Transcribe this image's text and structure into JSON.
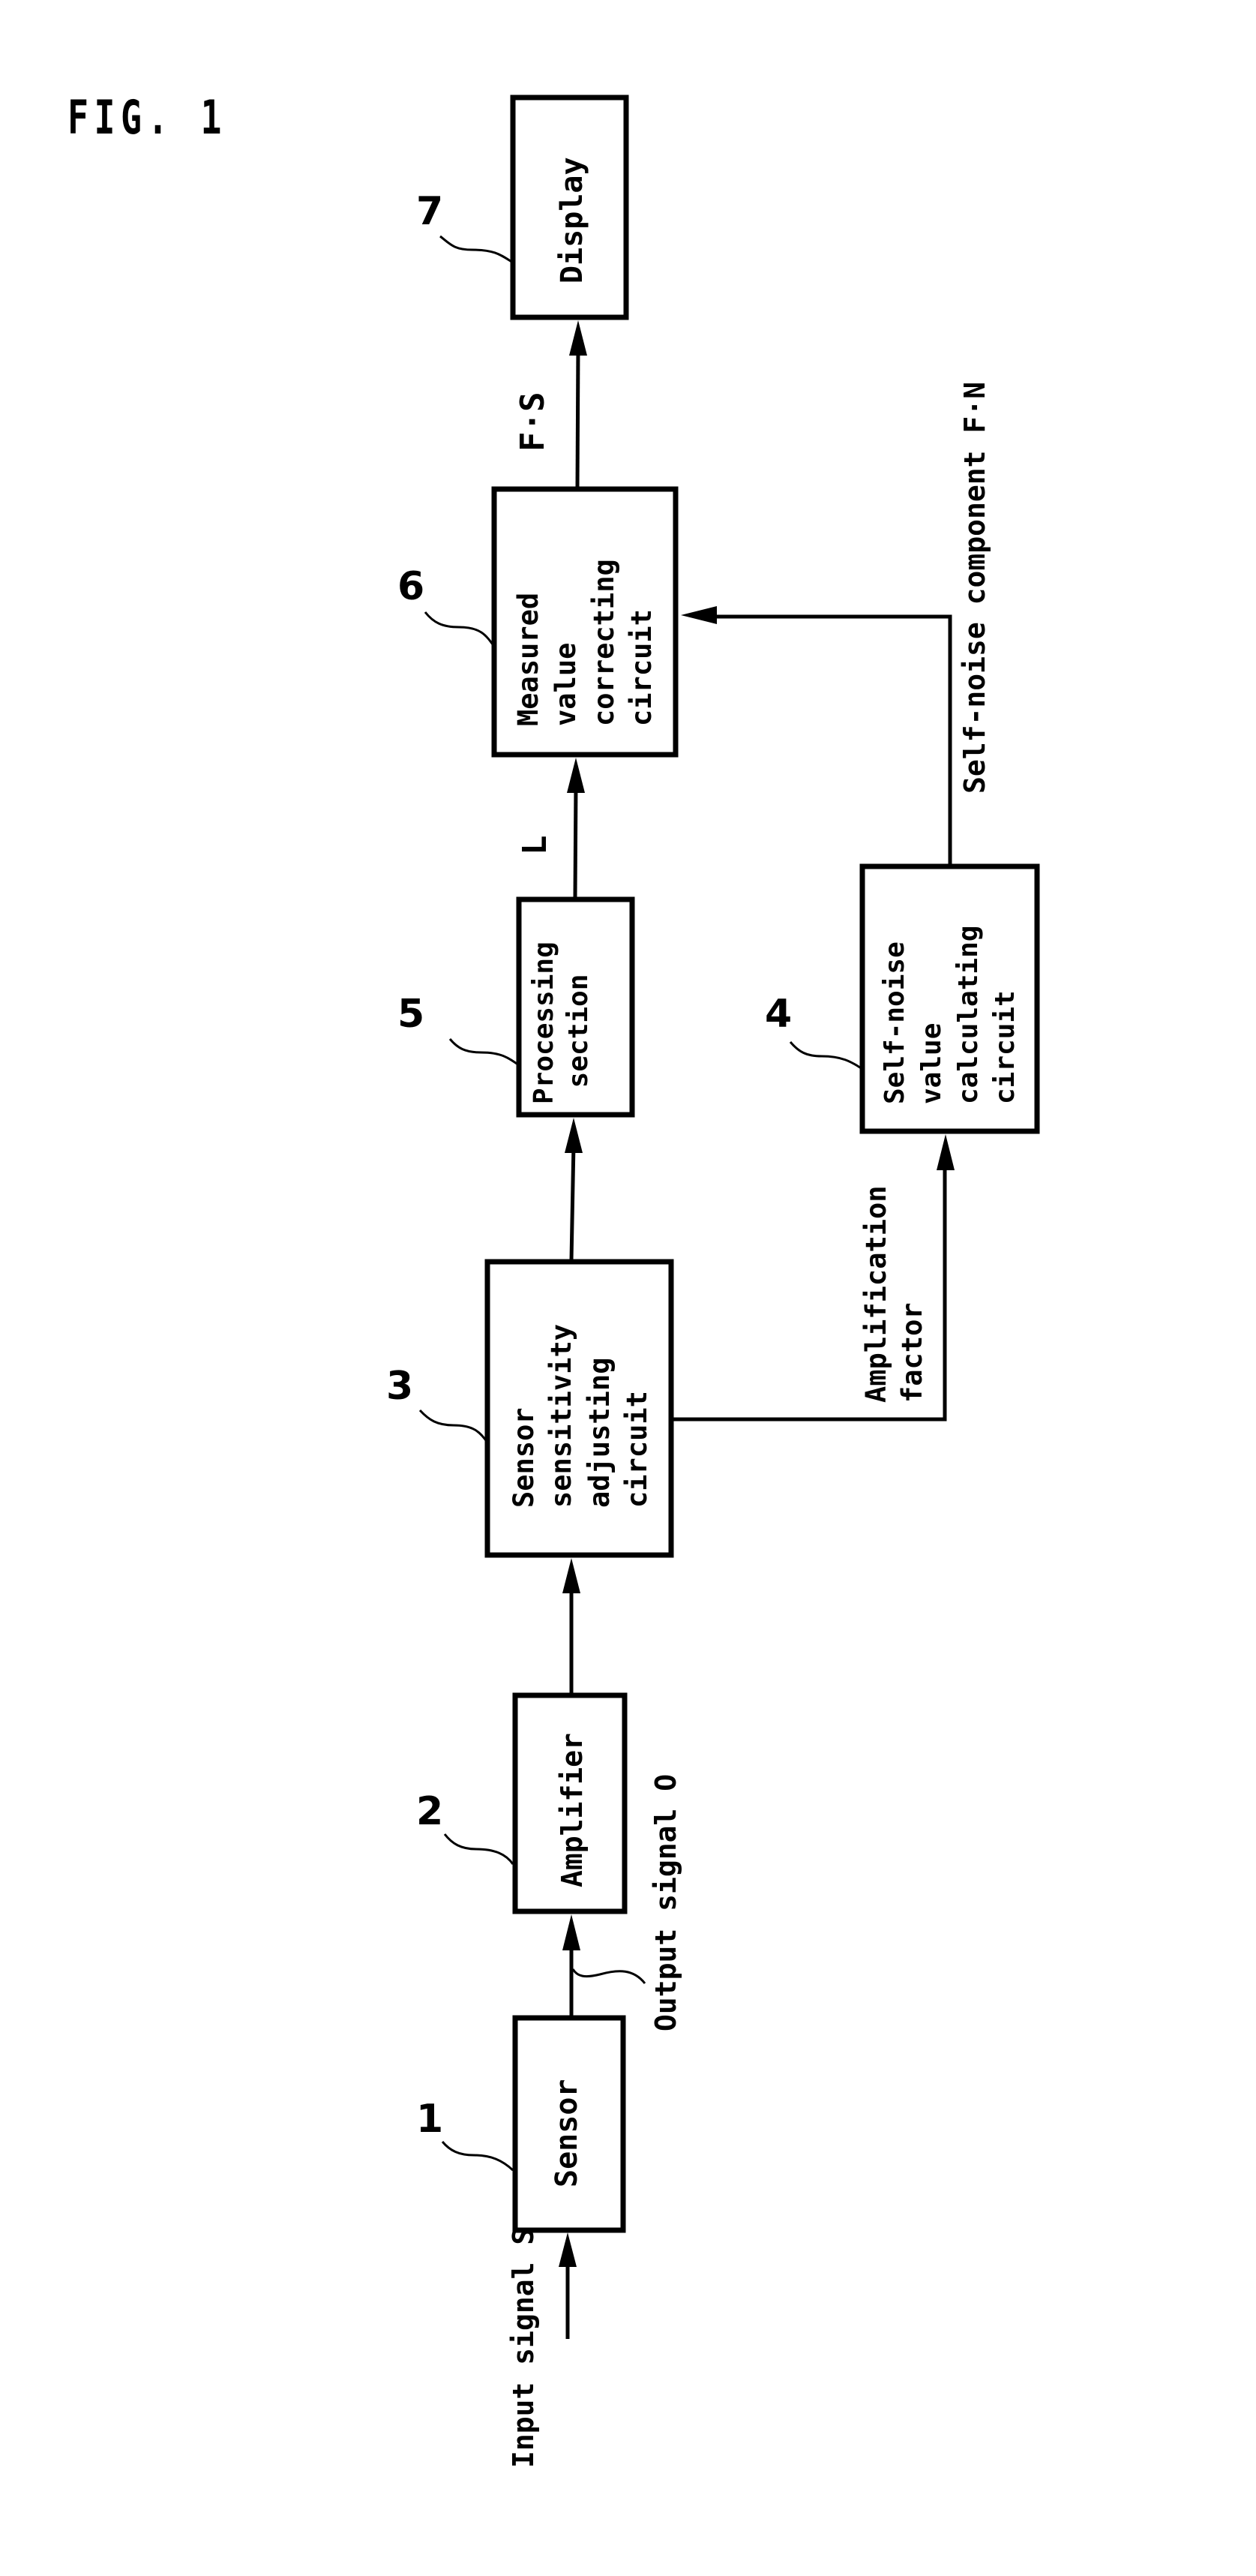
{
  "figure": {
    "title": "FIG. 1"
  },
  "blocks": {
    "sensor": {
      "number": "1",
      "label": "Sensor"
    },
    "amplifier": {
      "number": "2",
      "label": "Amplifier"
    },
    "sensitivity": {
      "number": "3",
      "label": "Sensor\nsensitivity\nadjusting\ncircuit"
    },
    "self_noise": {
      "number": "4",
      "label": "Self-noise\nvalue\ncalculating\ncircuit"
    },
    "processing": {
      "number": "5",
      "label": "Processing\n section"
    },
    "correcting": {
      "number": "6",
      "label": "Measured\nvalue\ncorrecting\ncircuit"
    },
    "display": {
      "number": "7",
      "label": "Display"
    }
  },
  "signals": {
    "input": "Input signal S",
    "output": "Output signal O",
    "amplification": "Amplification\nfactor",
    "processed": "L",
    "self_noise_component": "Self-noise component F·N",
    "corrected": "F·S"
  }
}
